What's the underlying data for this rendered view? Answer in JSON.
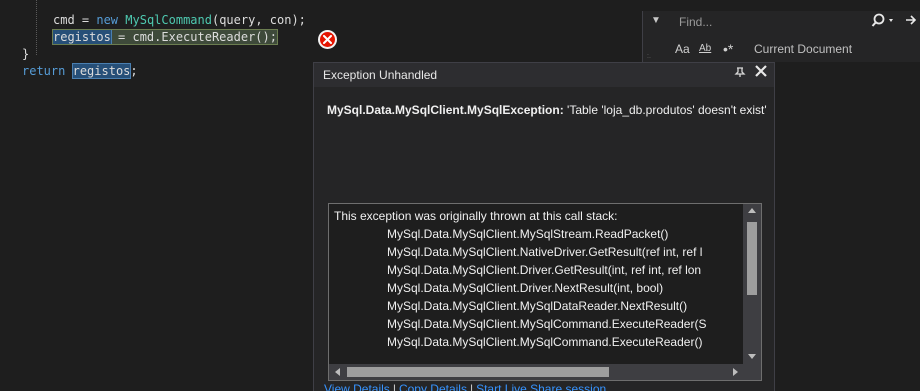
{
  "editor": {
    "line1": {
      "lhs": "cmd = ",
      "kw_new": "new",
      "type": "MySqlCommand",
      "args": "(query, con);"
    },
    "line2": {
      "var": "registos",
      "rest": " = cmd.ExecuteReader();"
    },
    "line3": {
      "brace": "}"
    },
    "line4": {
      "kw_return": "return",
      "var": "registos",
      "semi": ";"
    }
  },
  "find": {
    "placeholder": "Find...",
    "options": {
      "match_case": "Aa",
      "whole_word": "Ab",
      "regex": "•*"
    },
    "scope": "Current Document"
  },
  "exception": {
    "title": "Exception Unhandled",
    "type": "MySql.Data.MySqlClient.MySqlException:",
    "message": " 'Table 'loja_db.produtos' doesn't exist'",
    "stack_intro": "This exception was originally thrown at this call stack:",
    "frames": [
      "MySql.Data.MySqlClient.MySqlStream.ReadPacket()",
      "MySql.Data.MySqlClient.NativeDriver.GetResult(ref int, ref l",
      "MySql.Data.MySqlClient.Driver.GetResult(int, ref int, ref lon",
      "MySql.Data.MySqlClient.Driver.NextResult(int, bool)",
      "MySql.Data.MySqlClient.MySqlDataReader.NextResult()",
      "MySql.Data.MySqlClient.MySqlCommand.ExecuteReader(S",
      "MySql.Data.MySqlClient.MySqlCommand.ExecuteReader()"
    ],
    "links": {
      "view_details": "View Details",
      "copy_details": "Copy Details",
      "live_share": "Start Live Share session..."
    }
  },
  "colors": {
    "background": "#1e1e1e",
    "keyword": "#569cd6",
    "type": "#4ec9b0",
    "error": "#e51400",
    "link": "#3794ff"
  },
  "icons": {
    "error": "error-circle-icon",
    "search": "search-icon",
    "next": "find-next-icon",
    "pin": "pin-icon",
    "close": "close-icon"
  }
}
